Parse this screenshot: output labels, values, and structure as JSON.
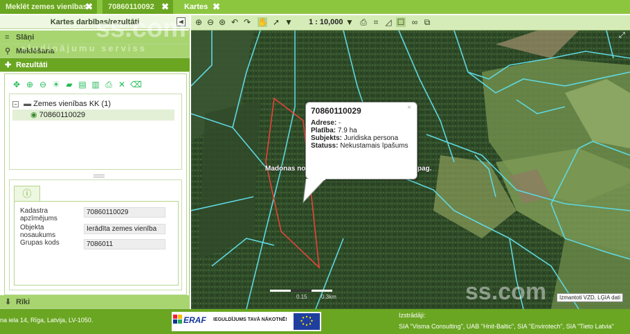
{
  "tabs": [
    {
      "label": "Meklēt zemes vienības",
      "close": "✖"
    },
    {
      "label": "70860110092",
      "close": "✖"
    },
    {
      "label": "Kartes",
      "close": "✖"
    }
  ],
  "left_panel": {
    "title": "Kartes darbības/rezultāti",
    "sections": {
      "layers": "Slāņi",
      "search": "Meklēšana",
      "results": "Rezultāti",
      "tools": "Rīki"
    },
    "tree": {
      "group_label": "Zemes vienības KK (1)",
      "item_label": "70860110029"
    },
    "fields": [
      {
        "label": "Kadastra apzīmējums",
        "value": "70860110029"
      },
      {
        "label": "Objekta nosaukums",
        "value": "Ierādīta zemes vienība"
      },
      {
        "label": "Grupas kods",
        "value": "7086011"
      }
    ]
  },
  "map": {
    "scale": "1 : 10,000",
    "popup": {
      "title": "70860110029",
      "close": "×",
      "address_label": "Adrese:",
      "address_value": "-",
      "area_label": "Platība:",
      "area_value": "7.9 ha",
      "subject_label": "Subjekts:",
      "subject_value": "Juridiska persona",
      "status_label": "Statuss:",
      "status_value": "Nekustamais īpašums"
    },
    "place_label_left": "Madonas no",
    "place_label_right": "pag.",
    "scalebar_labels": [
      "0.15",
      "0.3km"
    ],
    "attribution": "Izmantoti VZD, LĢIA dati"
  },
  "watermarks": {
    "site": "ss.com",
    "tagline": "sludinājumu serviss"
  },
  "footer": {
    "address": "na iela 14, Rīga, Latvija, LV-1050.",
    "eraf_logo": "ERAF",
    "eraf_slogan": "IEGULDĪJUMS TAVĀ NĀKOTNĒ!",
    "developer_title": "Izstrādāji:",
    "developers": "SIA \"Visma Consulting\", UAB \"Hnit-Baltic\", SIA \"Envirotech\", SIA \"Tieto Latvia\""
  },
  "colors": {
    "accent": "#8cc63f",
    "accent_dark": "#6aa622",
    "parcel_outline": "#e8433a",
    "boundary_lines": "#5fd8e0"
  }
}
